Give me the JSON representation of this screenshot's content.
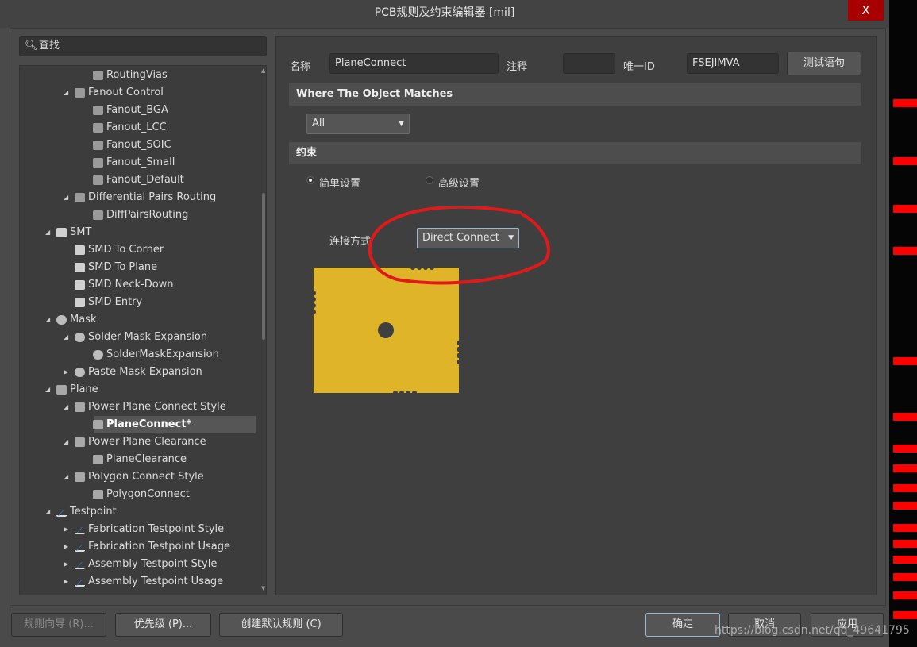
{
  "window": {
    "title": "PCB规则及约束编辑器 [mil]",
    "close_label": "X"
  },
  "search": {
    "placeholder": "查找",
    "icon": "search-icon"
  },
  "tree": [
    {
      "label": "RoutingVias",
      "level": 2,
      "arrow": "",
      "icon": "routing"
    },
    {
      "label": "Fanout Control",
      "level": 1,
      "arrow": "open",
      "icon": "routing"
    },
    {
      "label": "Fanout_BGA",
      "level": 2,
      "arrow": "",
      "icon": "routing"
    },
    {
      "label": "Fanout_LCC",
      "level": 2,
      "arrow": "",
      "icon": "routing"
    },
    {
      "label": "Fanout_SOIC",
      "level": 2,
      "arrow": "",
      "icon": "routing"
    },
    {
      "label": "Fanout_Small",
      "level": 2,
      "arrow": "",
      "icon": "routing"
    },
    {
      "label": "Fanout_Default",
      "level": 2,
      "arrow": "",
      "icon": "routing"
    },
    {
      "label": "Differential Pairs Routing",
      "level": 1,
      "arrow": "open",
      "icon": "routing"
    },
    {
      "label": "DiffPairsRouting",
      "level": 2,
      "arrow": "",
      "icon": "routing"
    },
    {
      "label": "SMT",
      "level": 0,
      "arrow": "open",
      "icon": "smt"
    },
    {
      "label": "SMD To Corner",
      "level": 1,
      "arrow": "",
      "icon": "smt"
    },
    {
      "label": "SMD To Plane",
      "level": 1,
      "arrow": "",
      "icon": "smt"
    },
    {
      "label": "SMD Neck-Down",
      "level": 1,
      "arrow": "",
      "icon": "smt"
    },
    {
      "label": "SMD Entry",
      "level": 1,
      "arrow": "",
      "icon": "smt"
    },
    {
      "label": "Mask",
      "level": 0,
      "arrow": "open",
      "icon": "mask"
    },
    {
      "label": "Solder Mask Expansion",
      "level": 1,
      "arrow": "open",
      "icon": "mask"
    },
    {
      "label": "SolderMaskExpansion",
      "level": 2,
      "arrow": "",
      "icon": "mask"
    },
    {
      "label": "Paste Mask Expansion",
      "level": 1,
      "arrow": "closed",
      "icon": "mask"
    },
    {
      "label": "Plane",
      "level": 0,
      "arrow": "open",
      "icon": "plane"
    },
    {
      "label": "Power Plane Connect Style",
      "level": 1,
      "arrow": "open",
      "icon": "plane"
    },
    {
      "label": "PlaneConnect*",
      "level": 2,
      "arrow": "",
      "icon": "plane",
      "selected": true
    },
    {
      "label": "Power Plane Clearance",
      "level": 1,
      "arrow": "open",
      "icon": "plane"
    },
    {
      "label": "PlaneClearance",
      "level": 2,
      "arrow": "",
      "icon": "plane"
    },
    {
      "label": "Polygon Connect Style",
      "level": 1,
      "arrow": "open",
      "icon": "plane"
    },
    {
      "label": "PolygonConnect",
      "level": 2,
      "arrow": "",
      "icon": "plane"
    },
    {
      "label": "Testpoint",
      "level": 0,
      "arrow": "open",
      "icon": "testpoint"
    },
    {
      "label": "Fabrication Testpoint Style",
      "level": 1,
      "arrow": "closed",
      "icon": "testpoint"
    },
    {
      "label": "Fabrication Testpoint Usage",
      "level": 1,
      "arrow": "closed",
      "icon": "testpoint"
    },
    {
      "label": "Assembly Testpoint Style",
      "level": 1,
      "arrow": "closed",
      "icon": "testpoint"
    },
    {
      "label": "Assembly Testpoint Usage",
      "level": 1,
      "arrow": "closed",
      "icon": "testpoint"
    }
  ],
  "rule": {
    "name_label": "名称",
    "name_value": "PlaneConnect",
    "comment_label": "注释",
    "comment_value": "",
    "uid_label": "唯一ID",
    "uid_value": "FSEJIMVA",
    "test_button": "测试语句"
  },
  "where": {
    "header": "Where The Object Matches",
    "selected": "All"
  },
  "constraints": {
    "header": "约束",
    "simple_label": "简单设置",
    "advanced_label": "高级设置",
    "selected_mode": "simple",
    "connect_label": "连接方式",
    "connect_value": "Direct Connect"
  },
  "colors": {
    "plane": "#e0b428",
    "annotation": "#e01a1a",
    "accent_close": "#a80000"
  },
  "footer": {
    "wizard": "规则向导 (R)...",
    "priority": "优先级 (P)...",
    "create_default": "创建默认规则 (C)",
    "ok": "确定",
    "cancel": "取消",
    "apply": "应用"
  },
  "watermark": "https://blog.csdn.net/qq_49641795"
}
